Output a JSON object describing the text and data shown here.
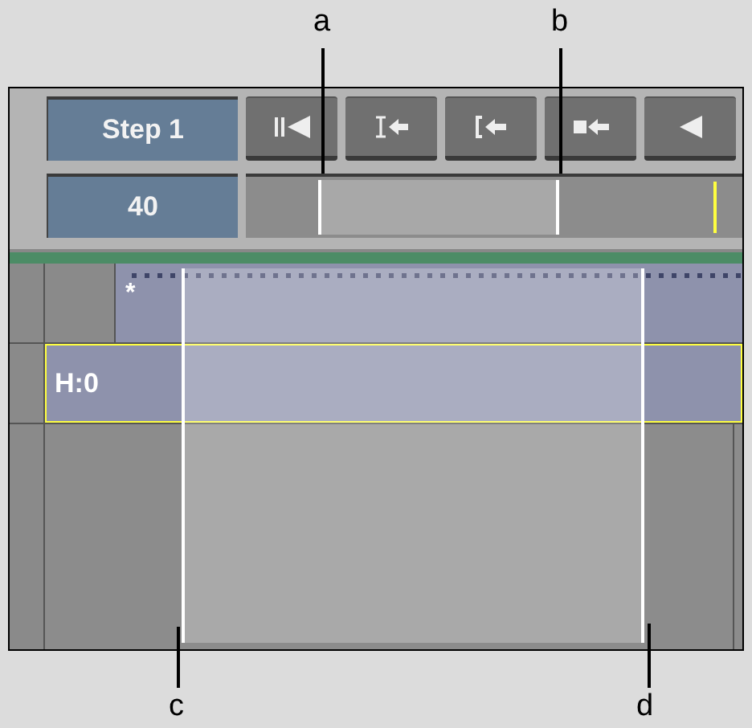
{
  "callouts": [
    {
      "label": "a"
    },
    {
      "label": "b"
    },
    {
      "label": "c"
    },
    {
      "label": "d"
    }
  ],
  "step_button": {
    "label": "Step 1"
  },
  "frame_field": {
    "value": "40"
  },
  "transport_buttons": [
    {
      "kind": "start"
    },
    {
      "kind": "in"
    },
    {
      "kind": "mark-in"
    },
    {
      "kind": "stop-back"
    },
    {
      "kind": "back"
    }
  ],
  "tracks": [
    {
      "kind": "video",
      "label": "*",
      "selected": false
    },
    {
      "kind": "head",
      "label": "H:0",
      "selected": true
    }
  ]
}
